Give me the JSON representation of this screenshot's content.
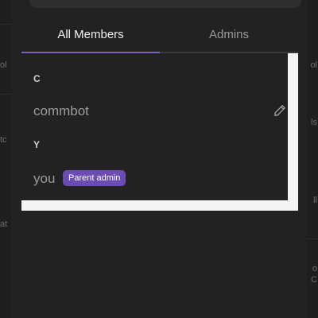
{
  "background": {
    "left_glyphs": [
      "ol",
      "tc",
      "at"
    ],
    "right_glyphs": [
      "ol",
      "ls",
      "ll",
      "o",
      "C"
    ]
  },
  "tabs": [
    {
      "label": "All Members",
      "active": true
    },
    {
      "label": "Admins",
      "active": false
    }
  ],
  "members": {
    "sections": [
      {
        "letter": "C",
        "items": [
          {
            "name": "commbot",
            "editable": true
          }
        ]
      },
      {
        "letter": "Y",
        "items": [
          {
            "name": "you",
            "badge": "Parent admin"
          }
        ]
      }
    ]
  },
  "colors": {
    "accent": "#7e5fc4",
    "badge": "#6b4bb4",
    "panel": "#222222"
  },
  "icons": [
    "pencil-icon"
  ]
}
